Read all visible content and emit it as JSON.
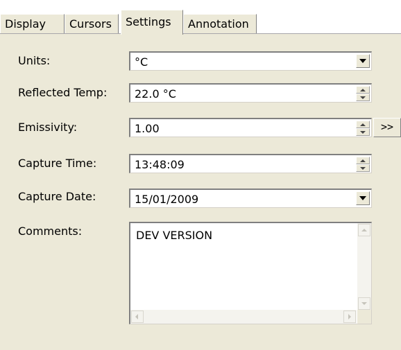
{
  "tabs": [
    {
      "label": "Display",
      "active": false
    },
    {
      "label": "Cursors",
      "active": false
    },
    {
      "label": "Settings",
      "active": true
    },
    {
      "label": "Annotation",
      "active": false
    }
  ],
  "settings": {
    "units": {
      "label": "Units:",
      "value": "°C",
      "control": "dropdown"
    },
    "reflected_temp": {
      "label": "Reflected Temp:",
      "value": "22.0 °C",
      "control": "spinner"
    },
    "emissivity": {
      "label": "Emissivity:",
      "value": "1.00",
      "control": "spinner",
      "more_label": ">>"
    },
    "capture_time": {
      "label": "Capture Time:",
      "value": "13:48:09",
      "control": "spinner"
    },
    "capture_date": {
      "label": "Capture Date:",
      "value": "15/01/2009",
      "control": "dropdown"
    },
    "comments": {
      "label": "Comments:",
      "value": "DEV VERSION",
      "control": "memo"
    }
  },
  "colors": {
    "panel": "#ece9d8",
    "field": "#ffffff",
    "border_dark": "#7f7f7f"
  }
}
